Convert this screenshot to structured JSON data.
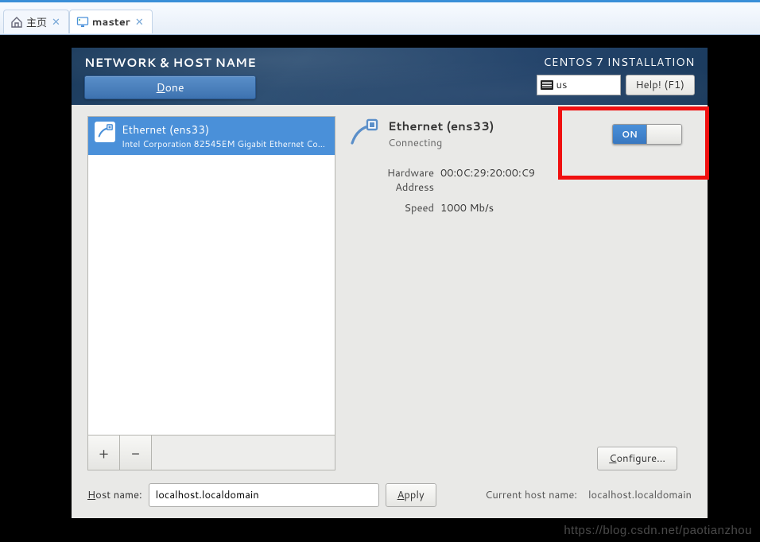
{
  "tabs": [
    {
      "label": "主页",
      "active": false
    },
    {
      "label": "master",
      "active": true
    }
  ],
  "header": {
    "title": "NETWORK & HOST NAME",
    "done_label": "Done",
    "install_label": "CENTOS 7 INSTALLATION",
    "keyboard_layout": "us",
    "help_label": "Help! (F1)"
  },
  "interfaces": [
    {
      "name": "Ethernet (ens33)",
      "device": "Intel Corporation 82545EM Gigabit Ethernet Controller (…"
    }
  ],
  "connection": {
    "title": "Ethernet (ens33)",
    "status": "Connecting",
    "toggle_state": "ON",
    "hardware_address_label": "Hardware Address",
    "hardware_address": "00:0C:29:20:00:C9",
    "speed_label": "Speed",
    "speed": "1000 Mb/s",
    "configure_label": "Configure..."
  },
  "buttons": {
    "add": "+",
    "remove": "−",
    "apply": "Apply"
  },
  "hostname": {
    "label_prefix": "H",
    "label_rest": "ost name:",
    "value": "localhost.localdomain",
    "current_label": "Current host name:",
    "current_value": "localhost.localdomain"
  },
  "watermark": "https://blog.csdn.net/paotianzhou"
}
